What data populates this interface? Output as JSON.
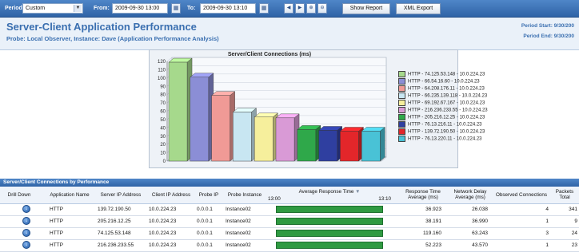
{
  "toolbar": {
    "period_label": "Period:",
    "period_value": "Custom",
    "from_label": "From:",
    "from_value": "2009-09-30 13:00",
    "to_label": "To:",
    "to_value": "2009-09-30 13:10",
    "show_report": "Show Report",
    "xml_export": "XML Export"
  },
  "header": {
    "title": "Server-Client Application Performance",
    "subtitle": "Probe: Local Observer, Instance: Dave (Application Performance Analysis)",
    "period_start": "Period Start: 9/30/200",
    "period_end": "Period End: 9/30/200"
  },
  "chart_data": {
    "type": "bar",
    "title": "Server/Client Connections (ms)",
    "ylim": [
      0,
      120
    ],
    "yticks": [
      0,
      10,
      20,
      30,
      40,
      50,
      60,
      70,
      80,
      90,
      100,
      110,
      120
    ],
    "grid": true,
    "legend_position": "right",
    "series": [
      {
        "name": "HTTP - 74.125.53.148 - 10.0.224.23",
        "value": 119,
        "color": "#a6d98c"
      },
      {
        "name": "HTTP - 66.54.16.60 - 10.0.224.23",
        "value": 101,
        "color": "#8b8ed6"
      },
      {
        "name": "HTTP - 64.208.176.11 - 10.0.224.23",
        "value": 79,
        "color": "#f09a96"
      },
      {
        "name": "HTTP - 66.235.139.118 - 10.0.224.23",
        "value": 59,
        "color": "#c8e6f2"
      },
      {
        "name": "HTTP - 69.192.67.167 - 10.0.224.23",
        "value": 53,
        "color": "#f6ef9c"
      },
      {
        "name": "HTTP - 216.236.233.55 - 10.0.224.23",
        "value": 52,
        "color": "#d99ad6"
      },
      {
        "name": "HTTP - 205.216.12.25 - 10.0.224.23",
        "value": 38,
        "color": "#2fa84a"
      },
      {
        "name": "HTTP - 76.13.216.11 - 10.0.224.23",
        "value": 37,
        "color": "#2f3fa0"
      },
      {
        "name": "HTTP - 139.72.190.50 - 10.0.224.23",
        "value": 36,
        "color": "#e3262a"
      },
      {
        "name": "HTTP - 76.13.220.11 - 10.0.224.23",
        "value": 36,
        "color": "#49c2d6"
      }
    ]
  },
  "table": {
    "section_title": "Server/Client Connections by Performance",
    "headers": {
      "drill_down": "Drill Down",
      "application_name": "Application Name",
      "server_ip": "Server IP Address",
      "client_ip": "Client IP Address",
      "probe_ip": "Probe IP",
      "probe_instance": "Probe Instance",
      "avg_response_time": "Average Response Time",
      "time_start": "13:00",
      "time_end": "13:10",
      "response_time_avg_1": "Response Time",
      "response_time_avg_2": "Average (ms)",
      "network_delay_1": "Network Delay",
      "network_delay_2": "Average (ms)",
      "observed_connections": "Observed Connections",
      "packets_1": "Packets",
      "packets_2": "Total"
    },
    "rows": [
      {
        "app": "HTTP",
        "server": "139.72.190.50",
        "client": "10.0.224.23",
        "probe": "0.0.0.1",
        "instance": "Instance02",
        "bar_fraction": 1.0,
        "response": "36.923",
        "delay": "26.038",
        "connections": "4",
        "packets": "341"
      },
      {
        "app": "HTTP",
        "server": "205.216.12.25",
        "client": "10.0.224.23",
        "probe": "0.0.0.1",
        "instance": "Instance02",
        "bar_fraction": 1.0,
        "response": "38.191",
        "delay": "36.990",
        "connections": "1",
        "packets": "9"
      },
      {
        "app": "HTTP",
        "server": "74.125.53.148",
        "client": "10.0.224.23",
        "probe": "0.0.0.1",
        "instance": "Instance02",
        "bar_fraction": 1.0,
        "response": "119.160",
        "delay": "63.243",
        "connections": "3",
        "packets": "24"
      },
      {
        "app": "HTTP",
        "server": "216.236.233.55",
        "client": "10.0.224.23",
        "probe": "0.0.0.1",
        "instance": "Instance02",
        "bar_fraction": 1.0,
        "response": "52.223",
        "delay": "43.570",
        "connections": "1",
        "packets": "23"
      }
    ]
  }
}
